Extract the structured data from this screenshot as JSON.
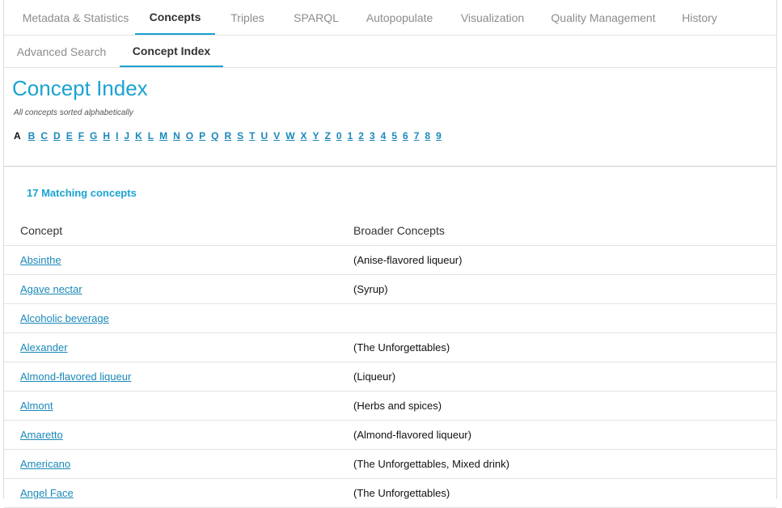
{
  "tabs": {
    "primary": [
      {
        "label": "Metadata & Statistics",
        "active": false
      },
      {
        "label": "Concepts",
        "active": true
      },
      {
        "label": "Triples",
        "active": false
      },
      {
        "label": "SPARQL",
        "active": false
      },
      {
        "label": "Autopopulate",
        "active": false
      },
      {
        "label": "Visualization",
        "active": false
      },
      {
        "label": "Quality Management",
        "active": false
      },
      {
        "label": "History",
        "active": false
      }
    ],
    "secondary": [
      {
        "label": "Advanced Search",
        "active": false
      },
      {
        "label": "Concept Index",
        "active": true
      }
    ]
  },
  "page": {
    "title": "Concept Index",
    "subtitle": "All concepts sorted alphabetically",
    "current_letter": "A",
    "letters": [
      "B",
      "C",
      "D",
      "E",
      "F",
      "G",
      "H",
      "I",
      "J",
      "K",
      "L",
      "M",
      "N",
      "O",
      "P",
      "Q",
      "R",
      "S",
      "T",
      "U",
      "V",
      "W",
      "X",
      "Y",
      "Z",
      "0",
      "1",
      "2",
      "3",
      "4",
      "5",
      "6",
      "7",
      "8",
      "9"
    ],
    "matches": "17 Matching concepts"
  },
  "table": {
    "headers": {
      "concept": "Concept",
      "broader": "Broader Concepts"
    },
    "rows": [
      {
        "concept": "Absinthe",
        "broader": "(Anise-flavored liqueur)"
      },
      {
        "concept": "Agave nectar",
        "broader": "(Syrup)"
      },
      {
        "concept": "Alcoholic beverage",
        "broader": ""
      },
      {
        "concept": "Alexander",
        "broader": "(The Unforgettables)"
      },
      {
        "concept": "Almond-flavored liqueur",
        "broader": "(Liqueur)"
      },
      {
        "concept": "Almont",
        "broader": "(Herbs and spices)"
      },
      {
        "concept": "Amaretto",
        "broader": "(Almond-flavored liqueur)"
      },
      {
        "concept": "Americano",
        "broader": "(The Unforgettables, Mixed drink)"
      },
      {
        "concept": "Angel Face",
        "broader": "(The Unforgettables)"
      }
    ]
  }
}
